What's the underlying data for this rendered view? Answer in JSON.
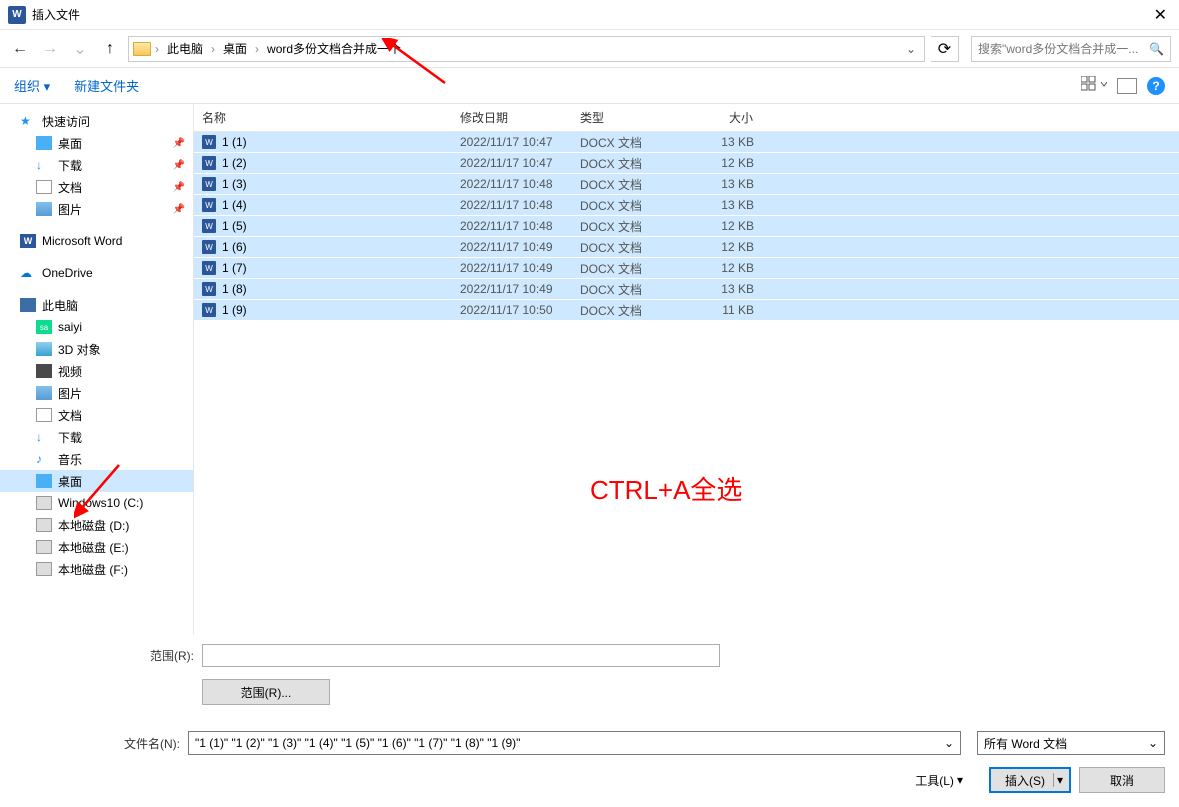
{
  "title": "插入文件",
  "nav": {
    "back": "←",
    "forward": "→",
    "dropdown": "⌄",
    "up": "↑"
  },
  "breadcrumbs": [
    "此电脑",
    "桌面",
    "word多份文档合并成一个"
  ],
  "refresh": "⟳",
  "search_placeholder": "搜索\"word多份文档合并成一...",
  "toolbar": {
    "organize": "组织 ▾",
    "newfolder": "新建文件夹",
    "help": "?"
  },
  "sidebar": {
    "quickaccess": "快速访问",
    "desktop": "桌面",
    "download": "下载",
    "documents": "文档",
    "pictures": "图片",
    "msword": "Microsoft Word",
    "onedrive": "OneDrive",
    "thispc": "此电脑",
    "saiyi": "saiyi",
    "obj3d": "3D 对象",
    "video": "视频",
    "pictures2": "图片",
    "documents2": "文档",
    "download2": "下载",
    "music": "音乐",
    "desktop2": "桌面",
    "drivec": "Windows10 (C:)",
    "drived": "本地磁盘 (D:)",
    "drivee": "本地磁盘 (E:)",
    "drivef": "本地磁盘 (F:)"
  },
  "columns": {
    "name": "名称",
    "date": "修改日期",
    "type": "类型",
    "size": "大小"
  },
  "files": [
    {
      "name": "1 (1)",
      "date": "2022/11/17 10:47",
      "type": "DOCX 文档",
      "size": "13 KB"
    },
    {
      "name": "1 (2)",
      "date": "2022/11/17 10:47",
      "type": "DOCX 文档",
      "size": "12 KB"
    },
    {
      "name": "1 (3)",
      "date": "2022/11/17 10:48",
      "type": "DOCX 文档",
      "size": "13 KB"
    },
    {
      "name": "1 (4)",
      "date": "2022/11/17 10:48",
      "type": "DOCX 文档",
      "size": "13 KB"
    },
    {
      "name": "1 (5)",
      "date": "2022/11/17 10:48",
      "type": "DOCX 文档",
      "size": "12 KB"
    },
    {
      "name": "1 (6)",
      "date": "2022/11/17 10:49",
      "type": "DOCX 文档",
      "size": "12 KB"
    },
    {
      "name": "1 (7)",
      "date": "2022/11/17 10:49",
      "type": "DOCX 文档",
      "size": "12 KB"
    },
    {
      "name": "1 (8)",
      "date": "2022/11/17 10:49",
      "type": "DOCX 文档",
      "size": "13 KB"
    },
    {
      "name": "1 (9)",
      "date": "2022/11/17 10:50",
      "type": "DOCX 文档",
      "size": "11 KB"
    }
  ],
  "annotation": "CTRL+A全选",
  "footer": {
    "range_label": "范围(R):",
    "range_btn": "范围(R)...",
    "filename_label": "文件名(N):",
    "filename_value": "\"1 (1)\" \"1 (2)\" \"1 (3)\" \"1 (4)\" \"1 (5)\" \"1 (6)\" \"1 (7)\" \"1 (8)\" \"1 (9)\"",
    "filter": "所有 Word 文档",
    "tools": "工具(L)",
    "insert": "插入(S)",
    "cancel": "取消"
  }
}
